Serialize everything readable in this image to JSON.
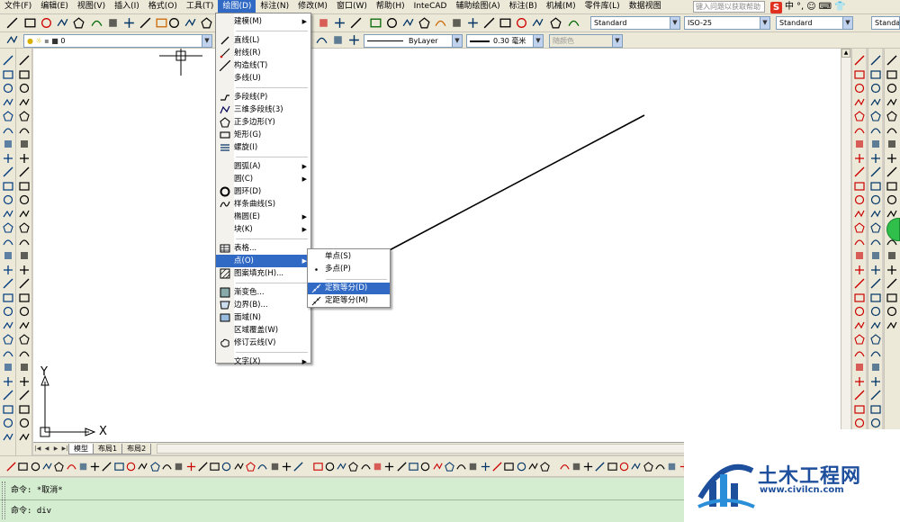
{
  "menubar": {
    "items": [
      "文件(F)",
      "编辑(E)",
      "视图(V)",
      "插入(I)",
      "格式(O)",
      "工具(T)",
      "绘图(D)",
      "标注(N)",
      "修改(M)",
      "窗口(W)",
      "帮助(H)",
      "InteCAD",
      "辅助绘图(A)",
      "标注(B)",
      "机械(M)",
      "零件库(L)",
      "数据视图"
    ],
    "active_index": 6,
    "help_placeholder": "键入问题以获取帮助",
    "ime_chars": [
      "中",
      "°,",
      "☺",
      "⌨",
      "👕"
    ]
  },
  "toolbar1": {
    "text_style": "Standard",
    "dim_style": "ISO-25",
    "table_style": "Standard",
    "multileader_style": "Standard"
  },
  "toolbar2": {
    "layer": "0",
    "linetype": "ByLayer",
    "lineweight": "0.30 毫米",
    "plotstyle": "随颜色"
  },
  "draw_menu": {
    "items": [
      {
        "label": "建模(M)",
        "icon": "",
        "submenu": true
      },
      {
        "sep": true
      },
      {
        "label": "直线(L)",
        "icon": "line-icon"
      },
      {
        "label": "射线(R)",
        "icon": "ray-icon"
      },
      {
        "label": "构造线(T)",
        "icon": "xline-icon"
      },
      {
        "label": "多线(U)",
        "icon": ""
      },
      {
        "sep": true
      },
      {
        "label": "多段线(P)",
        "icon": "polyline-icon"
      },
      {
        "label": "三维多段线(3)",
        "icon": "3dpoly-icon"
      },
      {
        "label": "正多边形(Y)",
        "icon": "polygon-icon"
      },
      {
        "label": "矩形(G)",
        "icon": "rectangle-icon"
      },
      {
        "label": "螺旋(I)",
        "icon": "helix-icon"
      },
      {
        "sep": true
      },
      {
        "label": "圆弧(A)",
        "icon": "",
        "submenu": true
      },
      {
        "label": "圆(C)",
        "icon": "",
        "submenu": true
      },
      {
        "label": "圆环(D)",
        "icon": "donut-icon"
      },
      {
        "label": "样条曲线(S)",
        "icon": "spline-icon"
      },
      {
        "label": "椭圆(E)",
        "icon": "",
        "submenu": true
      },
      {
        "label": "块(K)",
        "icon": "",
        "submenu": true
      },
      {
        "sep": true
      },
      {
        "label": "表格...",
        "icon": "table-icon"
      },
      {
        "label": "点(O)",
        "icon": "",
        "submenu": true,
        "highlight": true
      },
      {
        "label": "图案填充(H)...",
        "icon": "hatch-icon"
      },
      {
        "sep": true
      },
      {
        "label": "渐变色...",
        "icon": "gradient-icon"
      },
      {
        "label": "边界(B)...",
        "icon": "boundary-icon"
      },
      {
        "label": "面域(N)",
        "icon": "region-icon"
      },
      {
        "label": "区域覆盖(W)",
        "icon": ""
      },
      {
        "label": "修订云线(V)",
        "icon": "revcloud-icon"
      },
      {
        "sep": true
      },
      {
        "label": "文字(X)",
        "icon": "",
        "submenu": true
      }
    ]
  },
  "point_submenu": {
    "items": [
      {
        "label": "单点(S)",
        "icon": ""
      },
      {
        "label": "多点(P)",
        "icon": "point-icon"
      },
      {
        "sep": true
      },
      {
        "label": "定数等分(D)",
        "icon": "divide-icon",
        "highlight": true
      },
      {
        "label": "定距等分(M)",
        "icon": "measure-icon"
      }
    ]
  },
  "ucs": {
    "x_label": "X",
    "y_label": "Y"
  },
  "layout_tabs": [
    "模型",
    "布局1",
    "布局2"
  ],
  "command": {
    "line1": "命令: *取消*",
    "line2": "命令: div"
  },
  "watermark": {
    "title": "土木工程网",
    "url": "www.civilcn.com",
    "brand_color": "#1e4f9c"
  },
  "colors": {
    "menu_highlight": "#316ac5",
    "command_bg": "#d4ecd0",
    "chrome": "#ece9d8"
  }
}
